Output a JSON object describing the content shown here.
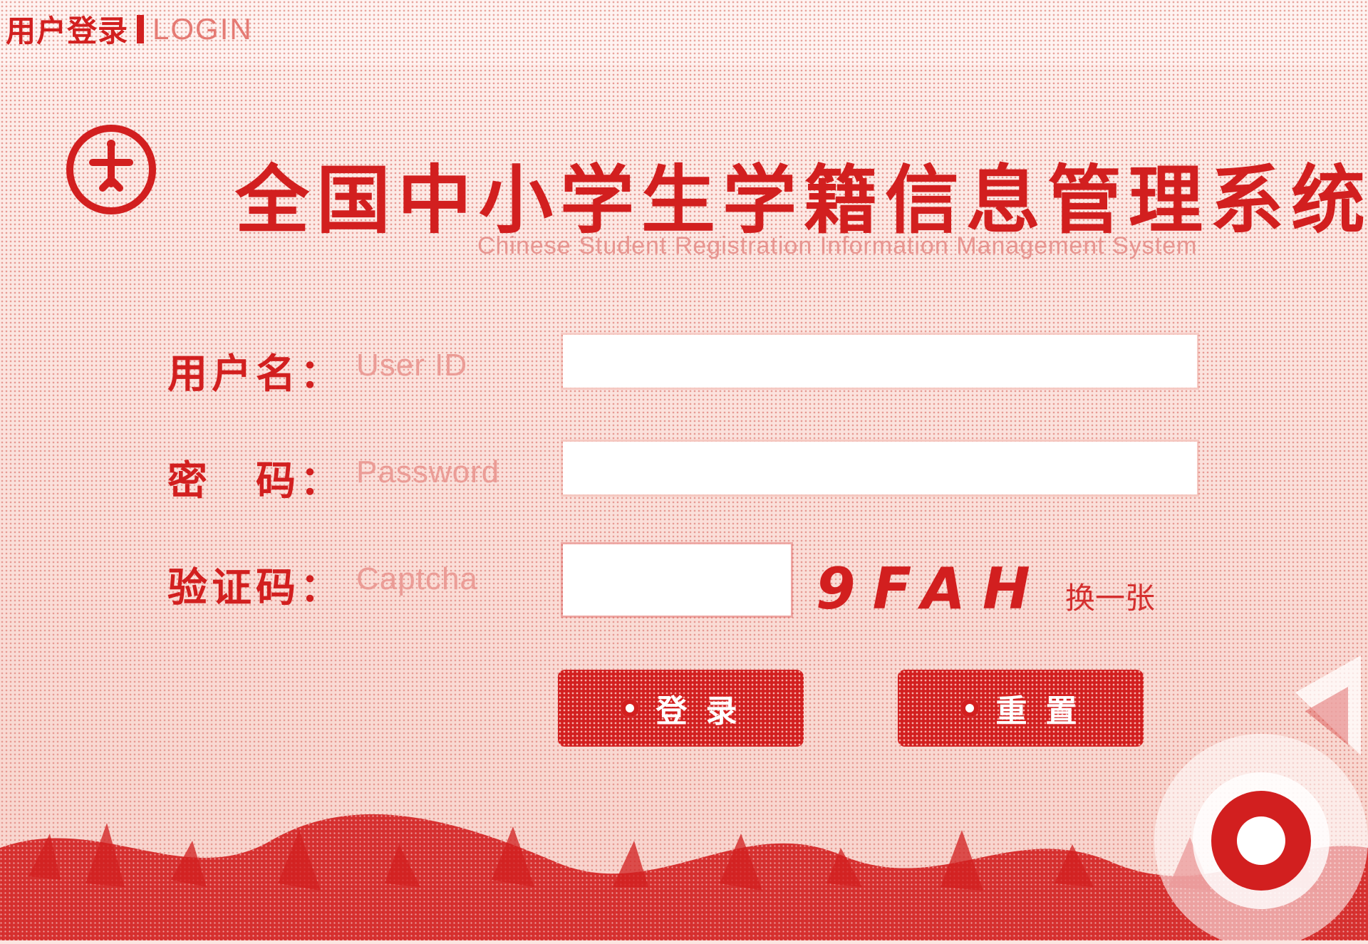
{
  "top": {
    "title_zh": "用户登录",
    "title_en": "LOGIN"
  },
  "header": {
    "title": "全国中小学生学籍信息管理系统",
    "subtitle": "Chinese Student Registration Information Management System"
  },
  "form": {
    "username": {
      "label_zh": "用户名：",
      "label_en": "User ID",
      "value": ""
    },
    "password": {
      "label_zh": "密　码：",
      "label_en": "Password",
      "value": ""
    },
    "captcha": {
      "label_zh": "验证码：",
      "label_en": "Captcha",
      "value": "",
      "code": "9FAH",
      "refresh_label": "换一张"
    }
  },
  "buttons": {
    "login": "登录",
    "reset": "重置"
  },
  "colors": {
    "primary": "#d21f1f",
    "background": "#fbe6e1",
    "muted": "#eb9c96"
  }
}
